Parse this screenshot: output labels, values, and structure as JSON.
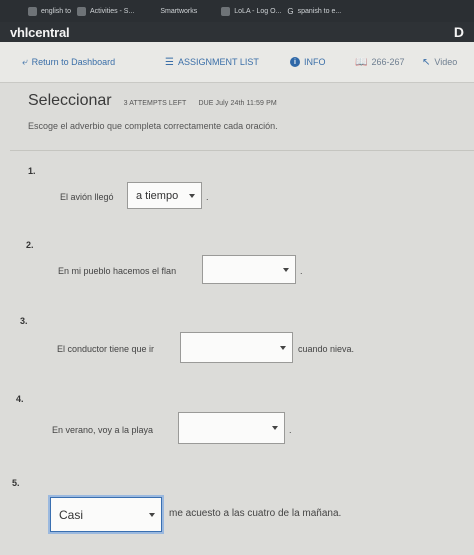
{
  "browser_tabs": [
    {
      "label": "english to"
    },
    {
      "label": "Activities - S..."
    },
    {
      "label": "Smartworks"
    },
    {
      "label": "LoLA - Log O..."
    },
    {
      "label": "spanish to e..."
    }
  ],
  "brand": {
    "name": "vhlcentral",
    "mark": "D"
  },
  "nav": {
    "return": "Return to Dashboard",
    "assignment_list": "ASSIGNMENT LIST",
    "info": "INFO",
    "page_range": "266-267",
    "video": "Video"
  },
  "activity": {
    "title": "Seleccionar",
    "attempts": "3 ATTEMPTS LEFT",
    "due": "DUE  July 24th 11:59 PM",
    "instructions": "Escoge el adverbio que completa correctamente cada oración."
  },
  "questions": [
    {
      "num": "1.",
      "before": "El avión llegó",
      "value": "a tiempo",
      "after": "."
    },
    {
      "num": "2.",
      "before": "En mi pueblo hacemos el flan",
      "value": "",
      "after": "."
    },
    {
      "num": "3.",
      "before": "El conductor tiene que ir",
      "value": "",
      "after": "cuando nieva."
    },
    {
      "num": "4.",
      "before": "En verano, voy a la playa",
      "value": "",
      "after": "."
    },
    {
      "num": "5.",
      "before": "",
      "value": "Casi",
      "after": "me acuesto a las cuatro de la mañana."
    }
  ],
  "colors": {
    "accent": "#3b6fa8",
    "focus": "#3a6fb0"
  }
}
